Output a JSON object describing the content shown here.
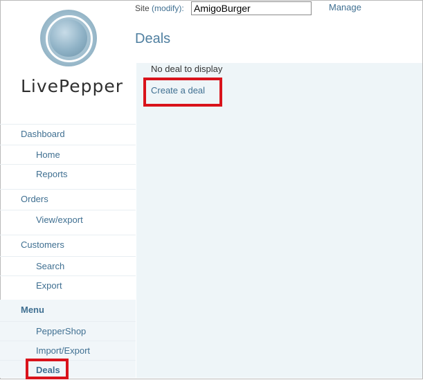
{
  "logo": {
    "text": "LivePepper",
    "icon": "livepepper-circle-logo"
  },
  "header": {
    "site_label": "Site",
    "modify_label": "(modify):",
    "site_value": "AmigoBurger",
    "manage_label": "Manage",
    "page_title": "Deals"
  },
  "sidebar": {
    "dashboard": "Dashboard",
    "home": "Home",
    "reports": "Reports",
    "orders": "Orders",
    "view_export": "View/export",
    "customers": "Customers",
    "search": "Search",
    "export": "Export",
    "menu": "Menu",
    "peppershop": "PepperShop",
    "import_export": "Import/Export",
    "deals": "Deals"
  },
  "main": {
    "empty_message": "No deal to display",
    "create_link": "Create a deal"
  },
  "colors": {
    "link": "#3f6f91",
    "highlight": "#d9131b",
    "panel": "#eef5f8"
  }
}
